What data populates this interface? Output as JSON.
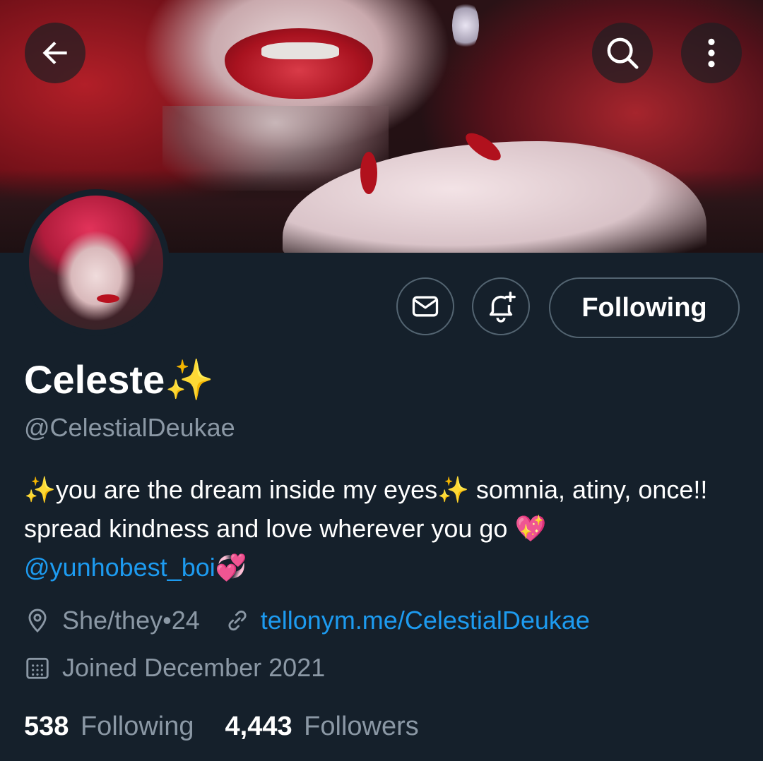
{
  "header": {
    "back_icon": "arrow-left-icon",
    "search_icon": "search-icon",
    "more_icon": "more-vertical-icon"
  },
  "profile": {
    "display_name": "Celeste",
    "name_emoji": "✨",
    "handle": "@CelestialDeukae",
    "bio_parts": {
      "emoji_start": "✨",
      "text_1": "you are the dream inside my eyes",
      "emoji_mid": "✨",
      "text_2": " somnia, atiny, once!! spread kindness and love wherever you go ",
      "emoji_heart": "💖",
      "mention": "@yunhobest_boi",
      "emoji_end": "💞"
    },
    "pronouns": "She/they•24",
    "website": "tellonym.me/CelestialDeukae",
    "joined": "Joined December 2021",
    "following_count": "538",
    "following_label": "Following",
    "followers_count": "4,443",
    "followers_label": "Followers"
  },
  "actions": {
    "message_icon": "mail-icon",
    "notify_icon": "bell-plus-icon",
    "follow_state_label": "Following"
  },
  "colors": {
    "background": "#15202b",
    "accent": "#1d9bf0",
    "muted": "#8b98a5",
    "border": "#536471"
  }
}
